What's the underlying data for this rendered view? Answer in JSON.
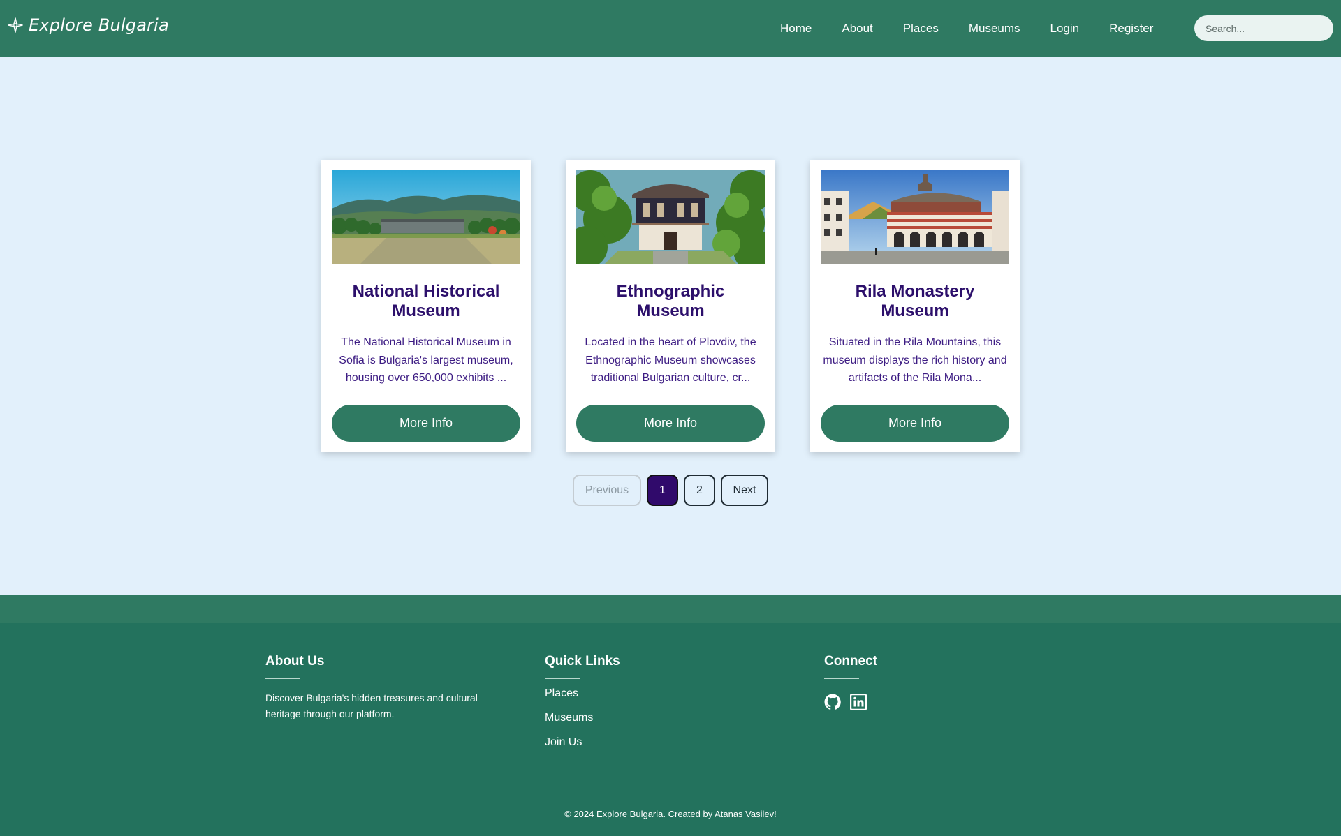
{
  "header": {
    "brand": "Explore Bulgaria",
    "brand_icon": "compass-star-icon",
    "nav": [
      "Home",
      "About",
      "Places",
      "Museums",
      "Login",
      "Register"
    ],
    "search_placeholder": "Search..."
  },
  "cards": [
    {
      "title": "National Historical Museum",
      "description": "The National Historical Museum in Sofia is Bulgaria's largest museum, housing over 650,000 exhibits ...",
      "button": "More Info"
    },
    {
      "title": "Ethnographic Museum",
      "description": "Located in the heart of Plovdiv, the Ethnographic Museum showcases traditional Bulgarian culture, cr...",
      "button": "More Info"
    },
    {
      "title": "Rila Monastery Museum",
      "description": "Situated in the Rila Mountains, this museum displays the rich history and artifacts of the Rila Mona...",
      "button": "More Info"
    }
  ],
  "pagination": {
    "previous": "Previous",
    "pages": [
      "1",
      "2"
    ],
    "current": "1",
    "next": "Next"
  },
  "footer": {
    "about_title": "About Us",
    "about_text": "Discover Bulgaria's hidden treasures and cultural heritage through our platform.",
    "links_title": "Quick Links",
    "links": [
      "Places",
      "Museums",
      "Join Us"
    ],
    "connect_title": "Connect",
    "social_icons": [
      "github-icon",
      "linkedin-icon"
    ],
    "copyright": "© 2024 Explore Bulgaria. Created by Atanas Vasilev!"
  },
  "colors": {
    "header_bg": "#2f7a62",
    "page_bg": "#e2f0fb",
    "footer_bg": "#23725d",
    "title_color": "#2c0f6b",
    "active_page": "#300a6b"
  }
}
